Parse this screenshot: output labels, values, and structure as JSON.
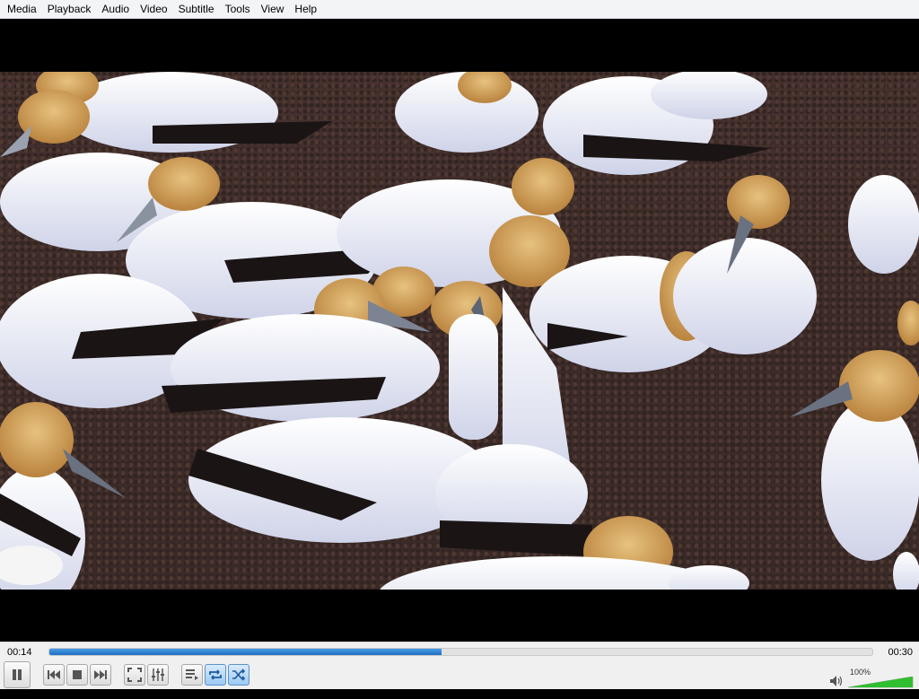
{
  "menu": [
    "Media",
    "Playback",
    "Audio",
    "Video",
    "Subtitle",
    "Tools",
    "View",
    "Help"
  ],
  "playback": {
    "current_time": "00:14",
    "total_time": "00:30",
    "progress_fraction": 0.477
  },
  "volume": {
    "label": "100%",
    "level_fraction": 1.0
  },
  "colors": {
    "accent": "#1f6fc2",
    "volume_green": "#2fbf2f"
  },
  "icons": {
    "pause": "pause-icon",
    "previous": "skip-previous-icon",
    "stop": "stop-icon",
    "next": "skip-next-icon",
    "fullscreen": "fullscreen-icon",
    "extended": "equalizer-icon",
    "playlist": "playlist-icon",
    "loop": "loop-icon",
    "random": "shuffle-icon",
    "mute": "speaker-icon"
  }
}
